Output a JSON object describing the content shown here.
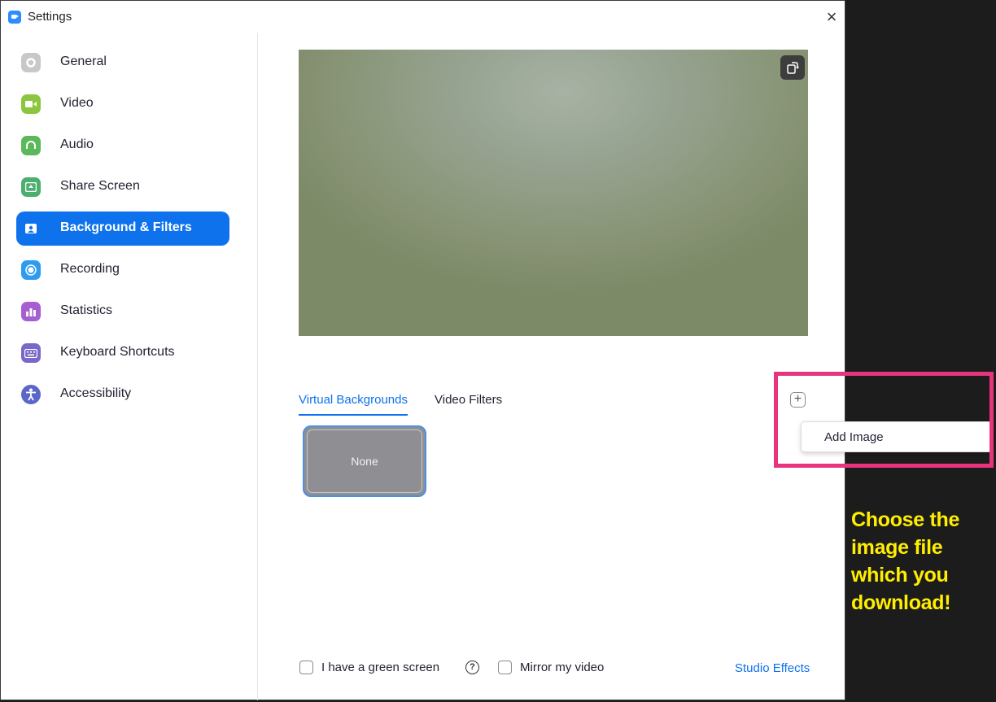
{
  "window": {
    "title": "Settings",
    "close_glyph": "×"
  },
  "sidebar": {
    "items": [
      {
        "label": "General",
        "icon": "gear-icon",
        "color": "#c8c8c8",
        "active": false
      },
      {
        "label": "Video",
        "icon": "video-camera-icon",
        "color": "#8cc63e",
        "active": false
      },
      {
        "label": "Audio",
        "icon": "headphones-icon",
        "color": "#5cb85c",
        "active": false
      },
      {
        "label": "Share Screen",
        "icon": "share-screen-icon",
        "color": "#4cae6f",
        "active": false
      },
      {
        "label": "Background & Filters",
        "icon": "background-icon",
        "color": "#0e72ed",
        "active": true
      },
      {
        "label": "Recording",
        "icon": "record-icon",
        "color": "#2d9cf0",
        "active": false
      },
      {
        "label": "Statistics",
        "icon": "statistics-icon",
        "color": "#a65fd1",
        "active": false
      },
      {
        "label": "Keyboard Shortcuts",
        "icon": "keyboard-icon",
        "color": "#7b68c9",
        "active": false
      },
      {
        "label": "Accessibility",
        "icon": "accessibility-icon",
        "color": "#5a67c8",
        "active": false
      }
    ]
  },
  "main": {
    "tabs": [
      {
        "label": "Virtual Backgrounds",
        "active": true
      },
      {
        "label": "Video Filters",
        "active": false
      }
    ],
    "backgrounds": [
      {
        "label": "None",
        "selected": true
      }
    ],
    "add_menu": {
      "items": [
        "Add Image"
      ]
    },
    "options": {
      "green_screen_label": "I have a green screen",
      "green_screen_checked": false,
      "mirror_label": "Mirror my video",
      "mirror_checked": false,
      "help_glyph": "?",
      "studio_effects_label": "Studio Effects"
    }
  },
  "annotation": {
    "text": "Choose the image file which you download!",
    "color": "#ffee00",
    "highlight_color": "#e8347c"
  },
  "colors": {
    "accent": "#0e72ed"
  }
}
